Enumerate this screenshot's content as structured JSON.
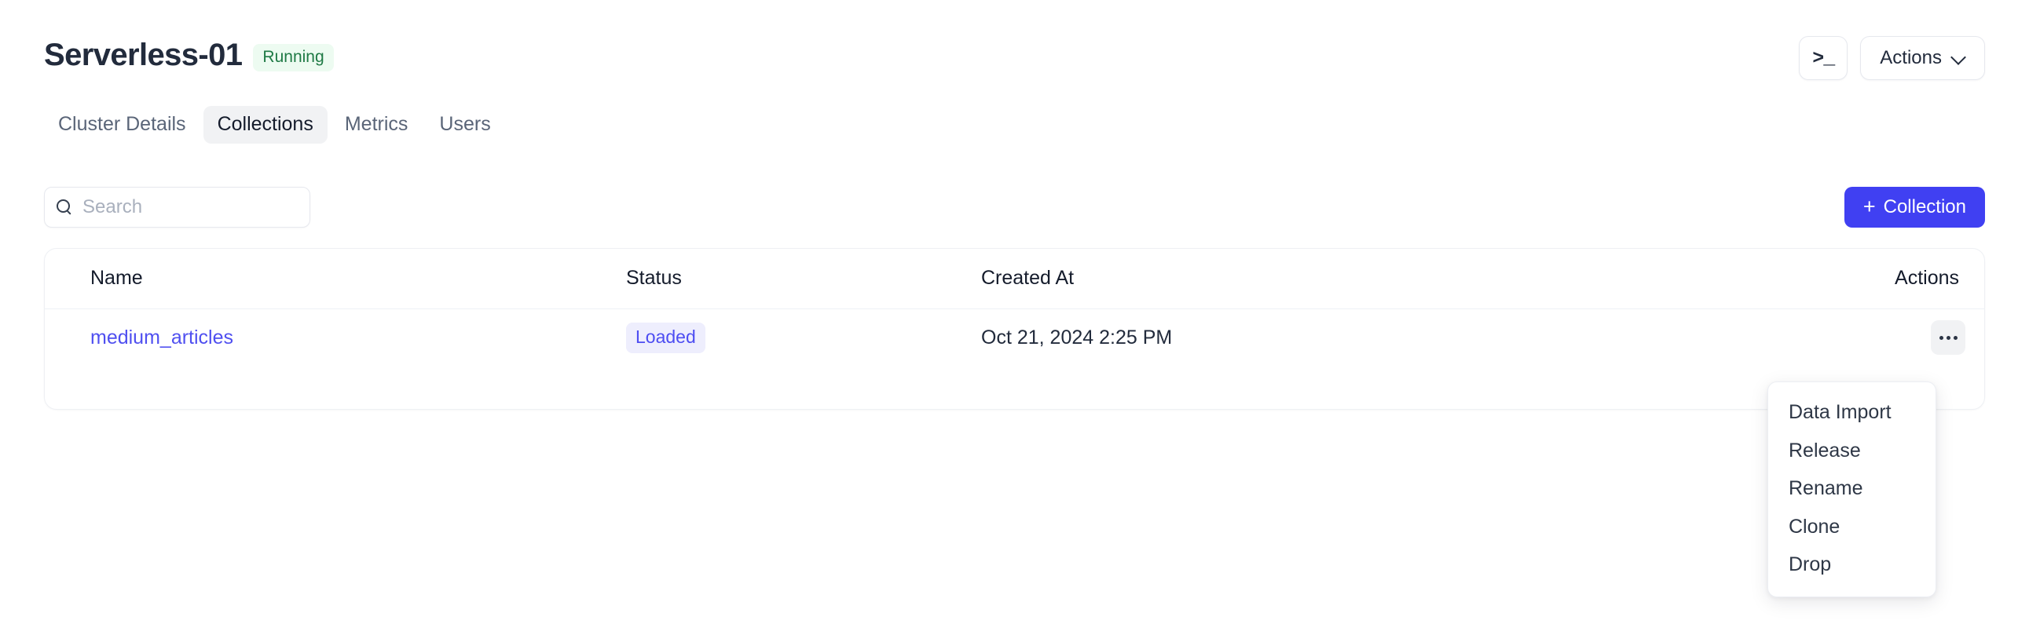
{
  "header": {
    "title": "Serverless-01",
    "status_badge": "Running",
    "status_badge_color": "#1f7a45",
    "status_badge_bg": "#edfbf1",
    "terminal_button_glyph": ">_",
    "terminal_button_icon": "terminal-icon",
    "actions_button_label": "Actions",
    "actions_chevron_icon": "chevron-down-icon"
  },
  "tabs": [
    {
      "label": "Cluster Details",
      "active": false
    },
    {
      "label": "Collections",
      "active": true
    },
    {
      "label": "Metrics",
      "active": false
    },
    {
      "label": "Users",
      "active": false
    }
  ],
  "toolbar": {
    "search_placeholder": "Search",
    "search_value": "",
    "search_icon": "search-icon",
    "create_button_label": "Collection",
    "create_button_plus": "+",
    "create_button_color": "#4040f2"
  },
  "table": {
    "columns": [
      "Name",
      "Status",
      "Created At",
      "Actions"
    ],
    "rows": [
      {
        "name": "medium_articles",
        "status": "Loaded",
        "status_color": "#4d4df2",
        "status_bg": "#eeeefd",
        "created_at": "Oct 21, 2024 2:25 PM",
        "actions_icon": "kebab-menu-icon"
      }
    ]
  },
  "dropdown": {
    "open": true,
    "items": [
      {
        "label": "Data Import"
      },
      {
        "label": "Release"
      },
      {
        "label": "Rename"
      },
      {
        "label": "Clone"
      },
      {
        "label": "Drop"
      }
    ]
  }
}
